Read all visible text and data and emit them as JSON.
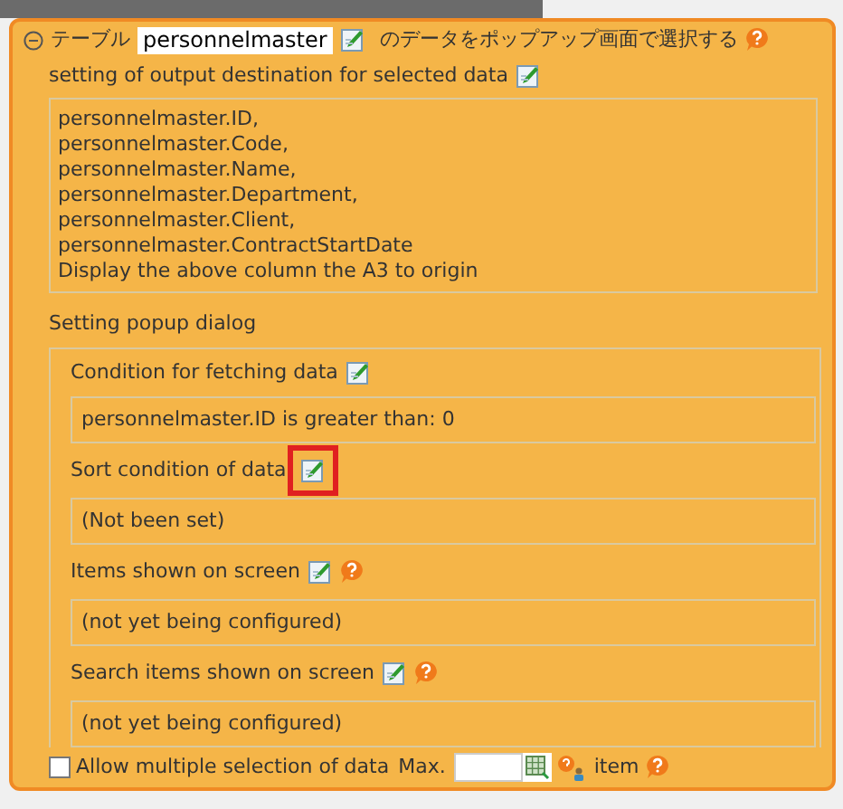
{
  "header": {
    "prefix": "テーブル",
    "table_name": "personnelmaster",
    "suffix": "のデータをポップアップ画面で選択する",
    "expanded": true
  },
  "output_section": {
    "title": "setting of output destination for selected data",
    "lines": [
      "personnelmaster.ID,",
      "personnelmaster.Code,",
      "personnelmaster.Name,",
      "personnelmaster.Department,",
      "personnelmaster.Client,",
      "personnelmaster.ContractStartDate",
      "Display the above column the A3 to origin"
    ]
  },
  "popup_section": {
    "title": "Setting popup dialog",
    "items": [
      {
        "label": "Condition for fetching data",
        "value": "personnelmaster.ID is greater than: 0",
        "help": false,
        "highlighted": false
      },
      {
        "label": "Sort condition of data",
        "value": "(Not been set)",
        "help": false,
        "highlighted": true
      },
      {
        "label": "Items shown on screen",
        "value": "(not yet being configured)",
        "help": true,
        "highlighted": false
      },
      {
        "label": "Search items shown on screen",
        "value": "(not yet being configured)",
        "help": true,
        "highlighted": false
      }
    ]
  },
  "multiple": {
    "label": "Allow multiple selection of data",
    "checked": false,
    "max_label": "Max.",
    "unit": "item"
  }
}
